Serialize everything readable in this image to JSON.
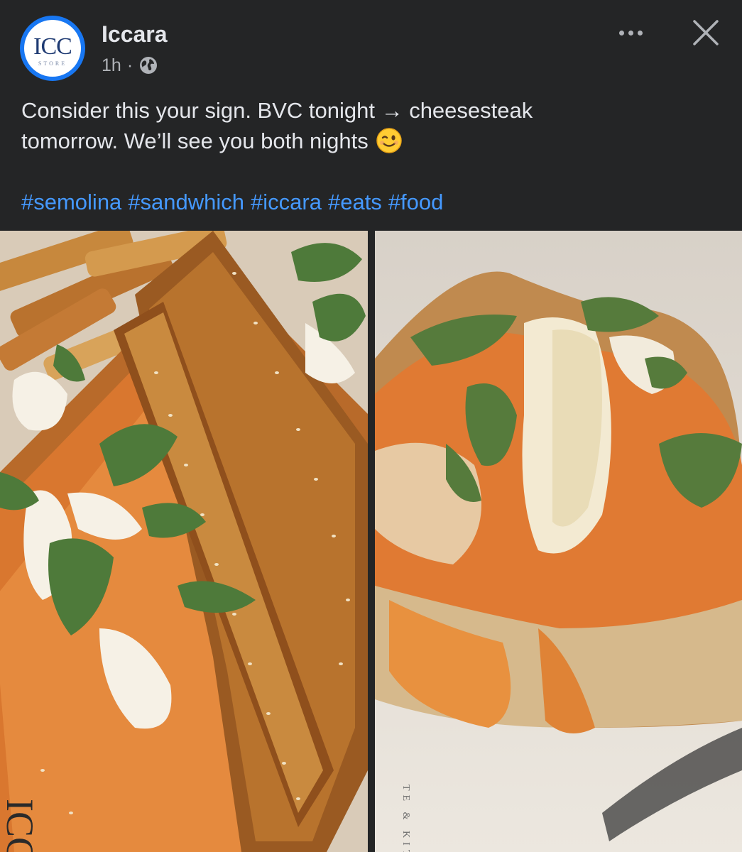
{
  "post": {
    "page_name": "Iccara",
    "avatar": {
      "mark": "ICC",
      "sub": "STORE"
    },
    "timestamp": "1h",
    "separator": "·",
    "audience_icon": "globe-icon",
    "text_line_1": "Consider this your sign. BVC tonight → cheesesteak",
    "text_line_2": "tomorrow. We’ll see you both nights",
    "emoji_icon": "winking-face-emoji-icon",
    "hashtags": [
      "#semolina",
      "#sandwhich",
      "#iccara",
      "#eats",
      "#food"
    ]
  },
  "header_actions": {
    "more_icon": "more-options-icon",
    "close_icon": "close-icon"
  },
  "photos": {
    "left": {
      "paper_print": "ICCA"
    },
    "right": {
      "paper_print": "TE & KIT"
    }
  },
  "colors": {
    "background": "#242526",
    "text_primary": "#e4e6eb",
    "text_secondary": "#b0b3b8",
    "hashtag": "#4599ff",
    "avatar_ring": "#1877f2"
  }
}
